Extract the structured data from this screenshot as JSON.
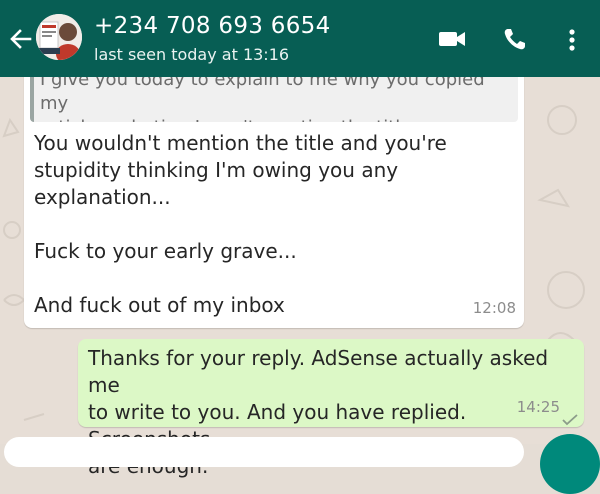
{
  "header": {
    "contact_name": "+234 708 693 6654",
    "status": "last seen today at 13:16",
    "icons": {
      "back": "arrow-back-icon",
      "video": "videocam-icon",
      "call": "phone-icon",
      "menu": "more-vert-icon"
    }
  },
  "messages": [
    {
      "direction": "incoming",
      "quoted_text": "I give you today to explain to me why you copied my\narticle verbatim. I won't mention the title now.",
      "text": "You wouldn't mention the title and you're\nstupidity thinking I'm owing you any\nexplanation...\n\nFuck to your early grave...\n\nAnd fuck out of my inbox",
      "time": "12:08"
    },
    {
      "direction": "outgoing",
      "text": "Thanks for your reply. AdSense actually asked me\nto write to you. And you have replied. Screenshots\nare enough.",
      "time": "14:25",
      "status_icon": "check-icon"
    }
  ],
  "colors": {
    "app_bar": "#075e54",
    "incoming_bubble": "#ffffff",
    "outgoing_bubble": "#dcf8c6",
    "wallpaper": "#e7ded6",
    "fab": "#00897b"
  }
}
